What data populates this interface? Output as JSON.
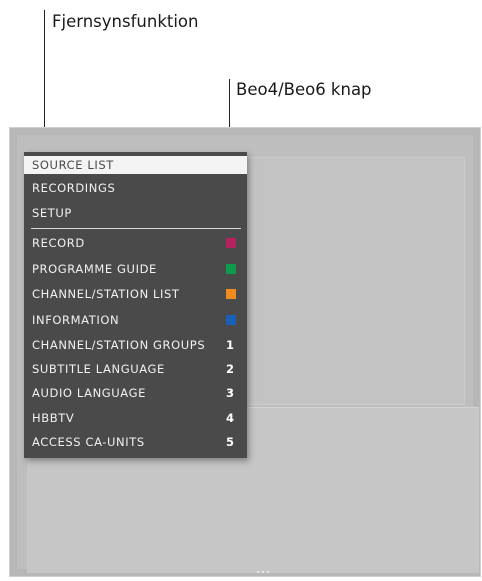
{
  "callouts": {
    "tv_function": "Fjernsynsfunktion",
    "remote_button": "Beo4/Beo6 knap"
  },
  "menu": {
    "items_top": [
      {
        "label": "SOURCE LIST",
        "selected": true
      },
      {
        "label": "RECORDINGS"
      },
      {
        "label": "SETUP"
      }
    ],
    "items_bottom": [
      {
        "label": "RECORD",
        "key": {
          "type": "color",
          "name": "red",
          "color": "#b4235e"
        }
      },
      {
        "label": "PROGRAMME GUIDE",
        "key": {
          "type": "color",
          "name": "green",
          "color": "#0f9b4e"
        }
      },
      {
        "label": "CHANNEL/STATION LIST",
        "key": {
          "type": "color",
          "name": "yellow",
          "color": "#f28b22"
        }
      },
      {
        "label": "INFORMATION",
        "key": {
          "type": "color",
          "name": "blue",
          "color": "#1a5fb4"
        }
      },
      {
        "label": "CHANNEL/STATION GROUPS",
        "key": {
          "type": "number",
          "value": "1"
        }
      },
      {
        "label": "SUBTITLE LANGUAGE",
        "key": {
          "type": "number",
          "value": "2"
        }
      },
      {
        "label": "AUDIO LANGUAGE",
        "key": {
          "type": "number",
          "value": "3"
        }
      },
      {
        "label": "HBBTV",
        "key": {
          "type": "number",
          "value": "4"
        }
      },
      {
        "label": "ACCESS CA-UNITS",
        "key": {
          "type": "number",
          "value": "5"
        }
      }
    ]
  }
}
